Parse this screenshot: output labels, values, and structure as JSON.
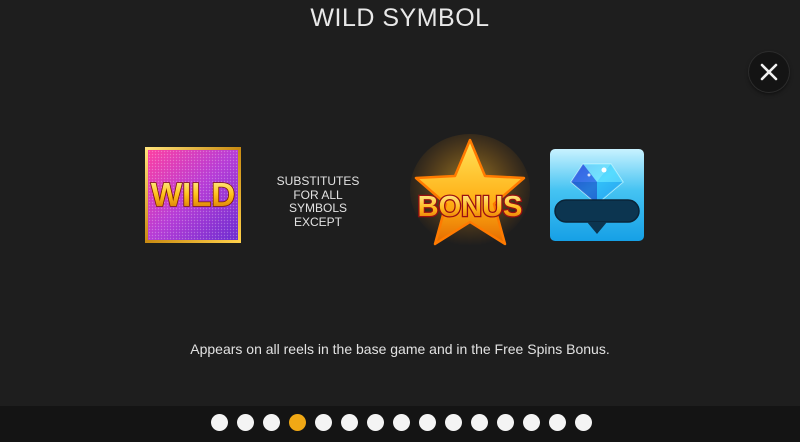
{
  "header": {
    "title": "WILD SYMBOL"
  },
  "close_button": {
    "icon": "close-icon",
    "label": "X"
  },
  "symbols": [
    {
      "name": "wild-symbol",
      "label": "WILD"
    },
    {
      "name": "bonus-symbol",
      "label": "BONUS"
    },
    {
      "name": "diamond-symbol",
      "icon": "diamond-icon"
    }
  ],
  "substitute_text": [
    "SUBSTITUTES",
    "FOR ALL",
    "SYMBOLS",
    "EXCEPT"
  ],
  "description": "Appears on all reels in the base game and in the Free Spins Bonus.",
  "pagination": {
    "total_pages": 15,
    "active_page": 4,
    "colors": {
      "inactive": "#f4f4f4",
      "active": "#f0a815"
    }
  },
  "colors": {
    "background": "#1e1e1e",
    "footer": "#141414"
  }
}
